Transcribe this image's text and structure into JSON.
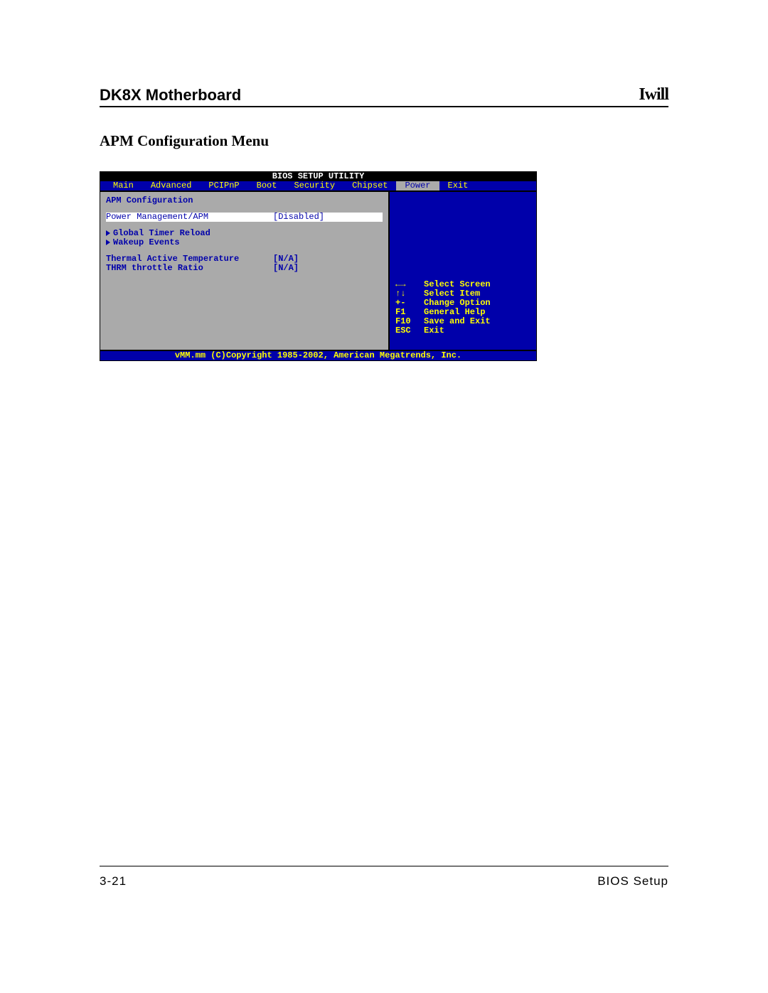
{
  "doc": {
    "header_title": "DK8X Motherboard",
    "logo_text": "Iwill",
    "section_title": "APM Configuration Menu",
    "page_number": "3-21",
    "footer_label": "BIOS Setup"
  },
  "bios": {
    "title": "BIOS SETUP UTILITY",
    "tabs": [
      "Main",
      "Advanced",
      "PCIPnP",
      "Boot",
      "Security",
      "Chipset",
      "Power",
      "Exit"
    ],
    "active_tab": "Power",
    "heading": "APM Configuration",
    "selected": {
      "label": "Power Management/APM",
      "value": "[Disabled]"
    },
    "submenus": [
      "Global Timer Reload",
      "Wakeup Events"
    ],
    "rows": [
      {
        "label": "Thermal Active Temperature",
        "value": "[N/A]"
      },
      {
        "label": "THRM throttle Ratio",
        "value": "[N/A]"
      }
    ],
    "help": [
      {
        "key": "←→",
        "txt": "Select Screen"
      },
      {
        "key": "↑↓",
        "txt": "Select Item"
      },
      {
        "key": "+-",
        "txt": "Change Option"
      },
      {
        "key": "F1",
        "txt": "General Help"
      },
      {
        "key": "F10",
        "txt": "Save and Exit"
      },
      {
        "key": "ESC",
        "txt": "Exit"
      }
    ],
    "copyright": "vMM.mm (C)Copyright 1985-2002, American Megatrends, Inc."
  }
}
